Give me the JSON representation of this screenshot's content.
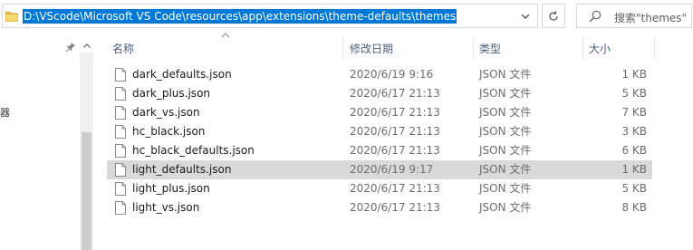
{
  "address": {
    "path": "D:\\VScode\\Microsoft VS Code\\resources\\app\\extensions\\theme-defaults\\themes"
  },
  "search": {
    "placeholder": "搜索\"themes\""
  },
  "nav": {
    "partial_label": "器"
  },
  "columns": {
    "name": "名称",
    "modified": "修改日期",
    "type": "类型",
    "size": "大小"
  },
  "files": [
    {
      "name": "dark_defaults.json",
      "modified": "2020/6/19 9:16",
      "type": "JSON 文件",
      "size": "1 KB",
      "selected": false
    },
    {
      "name": "dark_plus.json",
      "modified": "2020/6/17 21:13",
      "type": "JSON 文件",
      "size": "5 KB",
      "selected": false
    },
    {
      "name": "dark_vs.json",
      "modified": "2020/6/17 21:13",
      "type": "JSON 文件",
      "size": "7 KB",
      "selected": false
    },
    {
      "name": "hc_black.json",
      "modified": "2020/6/17 21:13",
      "type": "JSON 文件",
      "size": "3 KB",
      "selected": false
    },
    {
      "name": "hc_black_defaults.json",
      "modified": "2020/6/17 21:13",
      "type": "JSON 文件",
      "size": "6 KB",
      "selected": false
    },
    {
      "name": "light_defaults.json",
      "modified": "2020/6/19 9:17",
      "type": "JSON 文件",
      "size": "1 KB",
      "selected": true
    },
    {
      "name": "light_plus.json",
      "modified": "2020/6/17 21:13",
      "type": "JSON 文件",
      "size": "5 KB",
      "selected": false
    },
    {
      "name": "light_vs.json",
      "modified": "2020/6/17 21:13",
      "type": "JSON 文件",
      "size": "8 KB",
      "selected": false
    }
  ],
  "colors": {
    "selection_highlight": "#0078d7",
    "selected_row": "#d9d9d9",
    "header_text": "#4c607a",
    "folder": "#f0c44c"
  },
  "icons": {
    "folder": "folder-icon",
    "dropdown": "chevron-down-icon",
    "refresh": "refresh-icon",
    "search": "search-icon",
    "pin": "pin-icon",
    "file": "file-icon",
    "sort": "sort-up-icon"
  }
}
